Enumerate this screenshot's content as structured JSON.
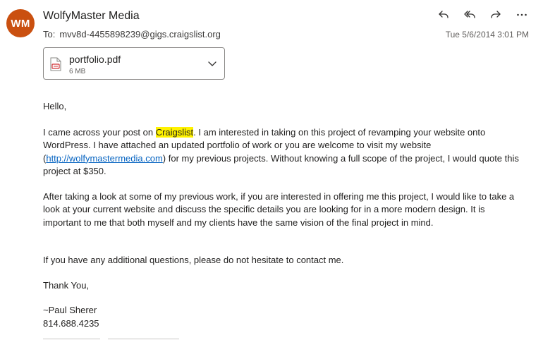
{
  "sender": {
    "initials": "WM",
    "name": "WolfyMaster Media",
    "avatar_color": "#ca5010"
  },
  "recipient": {
    "to_label": "To:",
    "address": "mvv8d-4455898239@gigs.craigslist.org"
  },
  "date": "Tue 5/6/2014 3:01 PM",
  "actions": [
    {
      "name": "reply",
      "icon": "reply-icon"
    },
    {
      "name": "reply-all",
      "icon": "reply-all-icon"
    },
    {
      "name": "forward",
      "icon": "forward-icon"
    },
    {
      "name": "more",
      "icon": "more-icon"
    }
  ],
  "attachment": {
    "filename": "portfolio.pdf",
    "size": "6 MB",
    "icon": "pdf-file-icon"
  },
  "message": {
    "greeting": "Hello,",
    "p1_before": "I came across your post on ",
    "p1_highlight": "Craigslist",
    "p1_mid": ". I am interested in taking on this project of revamping your website onto WordPress. I have attached an updated portfolio of work or you are welcome to visit my website (",
    "p1_link": "http://wolfymastermedia.com",
    "p1_after": ") for my previous projects. Without knowing a full scope of the project, I would quote this project at $350.",
    "p2": "After taking a look at some of my previous work, if you are interested in offering me this project, I would like to take a look at your current website and discuss the specific details you are looking for in a more modern design. It is important to me that both myself and my clients have the same vision of the final project in mind.",
    "p3": "If you have any additional questions, please do not hesitate to contact me.",
    "closing": "Thank You,",
    "signature_name": "~Paul Sherer",
    "signature_phone": "814.688.4235"
  }
}
